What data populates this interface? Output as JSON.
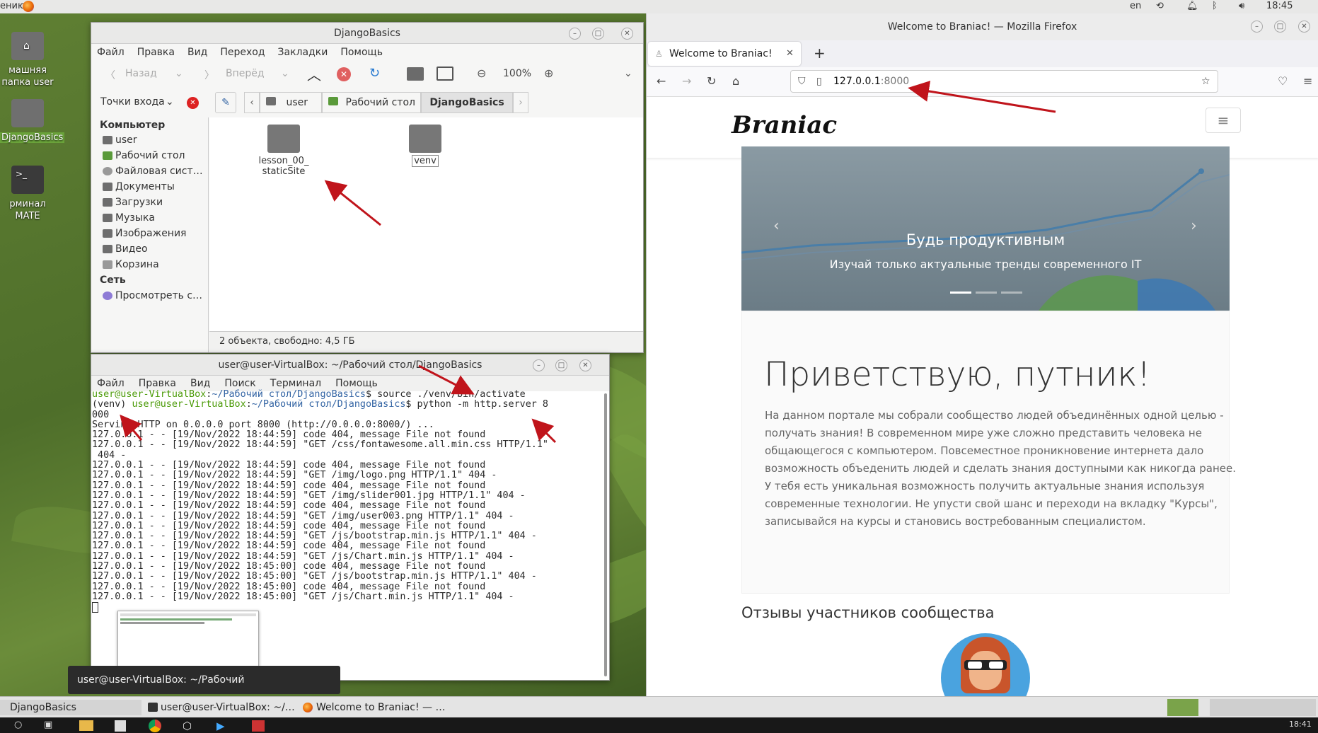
{
  "topbar": {
    "left_label": "ению",
    "lang": "en",
    "time": "18:45"
  },
  "desktop": {
    "icons": [
      "машняя папка user",
      "DjangoBasics",
      "рминал MATE"
    ]
  },
  "caja": {
    "title": "DjangoBasics",
    "menu": [
      "Файл",
      "Правка",
      "Вид",
      "Переход",
      "Закладки",
      "Помощь"
    ],
    "toolbar": {
      "back": "Назад",
      "forward": "Вперёд",
      "zoom": "100%"
    },
    "side_dropdown": "Точки входа",
    "breadcrumb": [
      "user",
      "Рабочий стол",
      "DjangoBasics"
    ],
    "sidebar": {
      "computer_header": "Компьютер",
      "items": [
        "user",
        "Рабочий стол",
        "Файловая сист…",
        "Документы",
        "Загрузки",
        "Музыка",
        "Изображения",
        "Видео",
        "Корзина"
      ],
      "network_header": "Сеть",
      "network_items": [
        "Просмотреть с…"
      ]
    },
    "files": [
      "lesson_00_ staticSite",
      "venv"
    ],
    "status": "2 объекта, свободно: 4,5 ГБ"
  },
  "terminal": {
    "title": "user@user-VirtualBox: ~/Рабочий стол/DjangoBasics",
    "menu": [
      "Файл",
      "Правка",
      "Вид",
      "Поиск",
      "Терминал",
      "Помощь"
    ],
    "prompt1": {
      "user": "user@user-VirtualBox",
      "path": "~/Рабочий стол/DjangoBasics",
      "cmd": "$ source ./venv/bin/activate"
    },
    "prompt2": {
      "venv": "(venv) ",
      "user": "user@user-VirtualBox",
      "path": "~/Рабочий стол/DjangoBasics",
      "cmd": "$ python -m http.server 8"
    },
    "lines": [
      "000",
      "Serving HTTP on 0.0.0.0 port 8000 (http://0.0.0.0:8000/) ...",
      "127.0.0.1 - - [19/Nov/2022 18:44:59] code 404, message File not found",
      "127.0.0.1 - - [19/Nov/2022 18:44:59] \"GET /css/fontawesome.all.min.css HTTP/1.1\"",
      " 404 -",
      "127.0.0.1 - - [19/Nov/2022 18:44:59] code 404, message File not found",
      "127.0.0.1 - - [19/Nov/2022 18:44:59] \"GET /img/logo.png HTTP/1.1\" 404 -",
      "127.0.0.1 - - [19/Nov/2022 18:44:59] code 404, message File not found",
      "127.0.0.1 - - [19/Nov/2022 18:44:59] \"GET /img/slider001.jpg HTTP/1.1\" 404 -",
      "127.0.0.1 - - [19/Nov/2022 18:44:59] code 404, message File not found",
      "127.0.0.1 - - [19/Nov/2022 18:44:59] \"GET /img/user003.png HTTP/1.1\" 404 -",
      "127.0.0.1 - - [19/Nov/2022 18:44:59] code 404, message File not found",
      "127.0.0.1 - - [19/Nov/2022 18:44:59] \"GET /js/bootstrap.min.js HTTP/1.1\" 404 -",
      "127.0.0.1 - - [19/Nov/2022 18:44:59] code 404, message File not found",
      "127.0.0.1 - - [19/Nov/2022 18:44:59] \"GET /js/Chart.min.js HTTP/1.1\" 404 -",
      "127.0.0.1 - - [19/Nov/2022 18:45:00] code 404, message File not found",
      "127.0.0.1 - - [19/Nov/2022 18:45:00] \"GET /js/bootstrap.min.js HTTP/1.1\" 404 -",
      "127.0.0.1 - - [19/Nov/2022 18:45:00] code 404, message File not found",
      "127.0.0.1 - - [19/Nov/2022 18:45:00] \"GET /js/Chart.min.js HTTP/1.1\" 404 -"
    ],
    "tooltip": "user@user-VirtualBox: ~/Рабочий стол/DjangoBasics"
  },
  "firefox": {
    "title": "Welcome to Braniac! — Mozilla Firefox",
    "tab": "Welcome to Braniac!",
    "url_host": "127.0.0.1",
    "url_port": ":8000",
    "site": {
      "logo": "Braniac",
      "slide_title": "Будь продуктивным",
      "slide_text": "Изучай только актуальные тренды современного IT",
      "heading": "Приветствую, путник!",
      "paragraph_lines": [
        "На данном портале мы собрали сообщество людей объединённых одной целью -",
        "получать знания! В современном мире уже сложно представить человека не",
        "общающегося с компьютером. Повсеместное проникновение интернета дало",
        "возможность объеденить людей и сделать знания доступными как никогда ранее.",
        "У тебя есть уникальная возможность получить актуальные знания используя",
        "современные технологии. Не упусти свой шанс и переходи на вкладку \"Курсы\",",
        "записывайся на курсы и становись востребованным специалистом."
      ],
      "reviews_heading": "Отзывы участников сообщества"
    }
  },
  "taskbar": {
    "items": [
      "DjangoBasics",
      "user@user-VirtualBox: ~/…",
      "Welcome to Braniac! — …"
    ]
  },
  "dock": {
    "time": "18:41"
  }
}
